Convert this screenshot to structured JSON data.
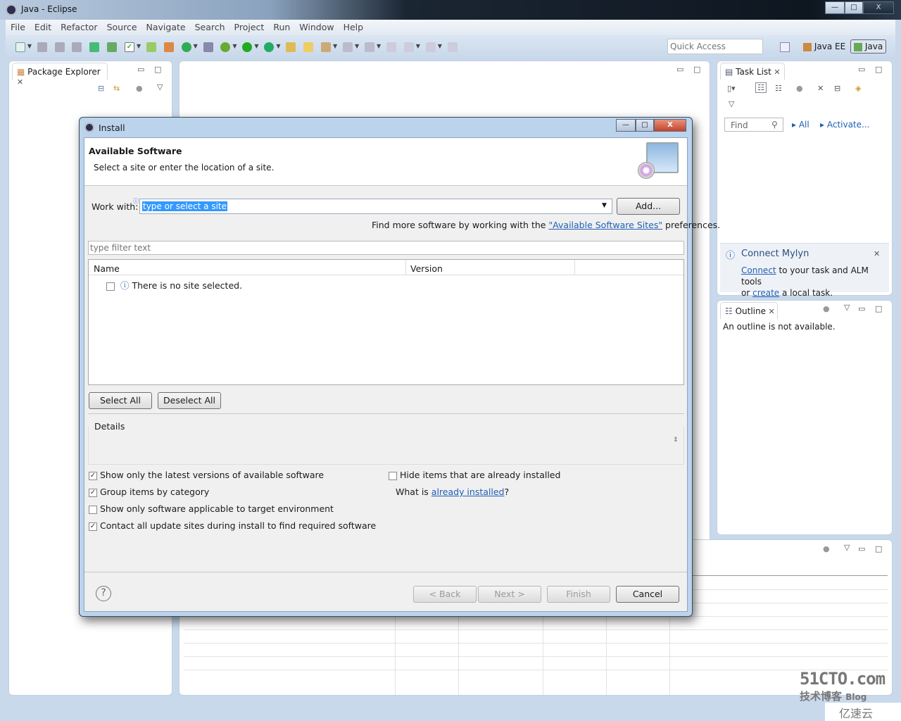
{
  "window": {
    "title": "Java - Eclipse",
    "min": "—",
    "max": "□",
    "close": "X"
  },
  "menu": [
    "File",
    "Edit",
    "Refactor",
    "Source",
    "Navigate",
    "Search",
    "Project",
    "Run",
    "Window",
    "Help"
  ],
  "toolbar": {
    "quick_access_placeholder": "Quick Access",
    "perspectives": [
      "Java EE",
      "Java"
    ]
  },
  "package_explorer": {
    "title": "Package Explorer"
  },
  "task_list": {
    "title": "Task List",
    "find_placeholder": "Find",
    "all": "All",
    "activate": "Activate..."
  },
  "mylyn": {
    "title": "Connect Mylyn",
    "connect": "Connect",
    "text1": " to your task and ALM tools",
    "or": "or ",
    "create": "create",
    "text2": " a local task."
  },
  "outline": {
    "title": "Outline",
    "message": "An outline is not available."
  },
  "dialog": {
    "title": "Install",
    "heading": "Available Software",
    "subheading": "Select a site or enter the location of a site.",
    "work_with_label": "Work with:",
    "work_with_value": "type or select a site",
    "add_button": "Add...",
    "find_more_prefix": "Find more software by working with the ",
    "find_more_link": "\"Available Software Sites\"",
    "find_more_suffix": " preferences.",
    "filter_placeholder": "type filter text",
    "columns": [
      "Name",
      "Version"
    ],
    "rows": [
      {
        "name": "There is no site selected.",
        "checked": false
      }
    ],
    "select_all": "Select All",
    "deselect_all": "Deselect All",
    "details_label": "Details",
    "options_left": [
      {
        "label": "Show only the latest versions of available software",
        "checked": true
      },
      {
        "label": "Group items by category",
        "checked": true
      },
      {
        "label": "Show only software applicable to target environment",
        "checked": false
      },
      {
        "label": "Contact all update sites during install to find required software",
        "checked": true
      }
    ],
    "hide_installed": {
      "label": "Hide items that are already installed",
      "checked": false
    },
    "what_is_prefix": "What is ",
    "what_is_link": "already installed",
    "what_is_suffix": "?",
    "help": "?",
    "back": "< Back",
    "next": "Next >",
    "finish": "Finish",
    "cancel": "Cancel"
  },
  "watermark": {
    "line1": "51CTO.com",
    "line2": "技术博客",
    "line3": "Blog",
    "brand": "亿速云"
  }
}
